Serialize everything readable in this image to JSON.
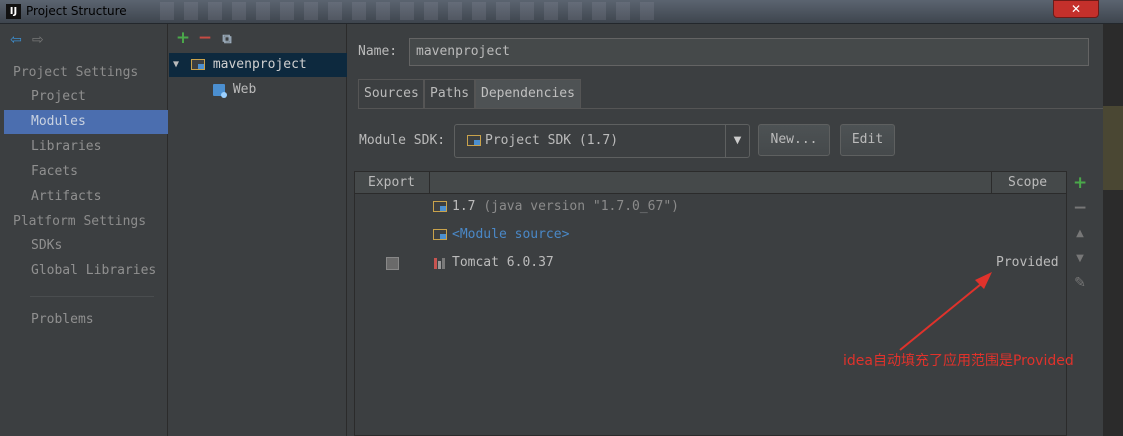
{
  "window": {
    "title": "Project Structure",
    "close_label": "✕"
  },
  "leftnav": {
    "back_icon": "arrow-left-icon",
    "forward_icon": "arrow-right-icon",
    "project_settings_heading": "Project Settings",
    "project_settings_items": [
      "Project",
      "Modules",
      "Libraries",
      "Facets",
      "Artifacts"
    ],
    "selected_item": "Modules",
    "platform_settings_heading": "Platform Settings",
    "platform_settings_items": [
      "SDKs",
      "Global Libraries"
    ],
    "problems_label": "Problems"
  },
  "tree": {
    "toolbar": {
      "add": "+",
      "remove": "−",
      "copy": "⧉"
    },
    "root": {
      "label": "mavenproject",
      "expanded": true
    },
    "children": [
      {
        "label": "Web"
      }
    ]
  },
  "module": {
    "name_label": "Name:",
    "name_value": "mavenproject",
    "tabs": [
      "Sources",
      "Paths",
      "Dependencies"
    ],
    "active_tab": "Dependencies",
    "sdk_label": "Module SDK:",
    "sdk_value": "Project SDK (1.7)",
    "new_button": "New...",
    "edit_button": "Edit"
  },
  "dependencies": {
    "columns": {
      "export": "Export",
      "scope": "Scope"
    },
    "rows": [
      {
        "name": "1.7",
        "detail": "(java version \"1.7.0_67\")",
        "scope": ""
      },
      {
        "name": "<Module source>",
        "detail": "",
        "scope": ""
      },
      {
        "name": "Tomcat 6.0.37",
        "detail": "",
        "scope": "Provided",
        "export_checked": false
      }
    ]
  },
  "side_tools": {
    "add": "+",
    "remove": "−",
    "up": "▲",
    "down": "▼",
    "edit": "✎"
  },
  "annotation": {
    "text": "idea自动填充了应用范围是Provided",
    "color": "#e0322b"
  },
  "colors": {
    "accent": "#4b6eaf",
    "tree_selection": "#0d293e",
    "link": "#4a88c7",
    "add": "#4aa84a",
    "remove": "#c74b43"
  }
}
